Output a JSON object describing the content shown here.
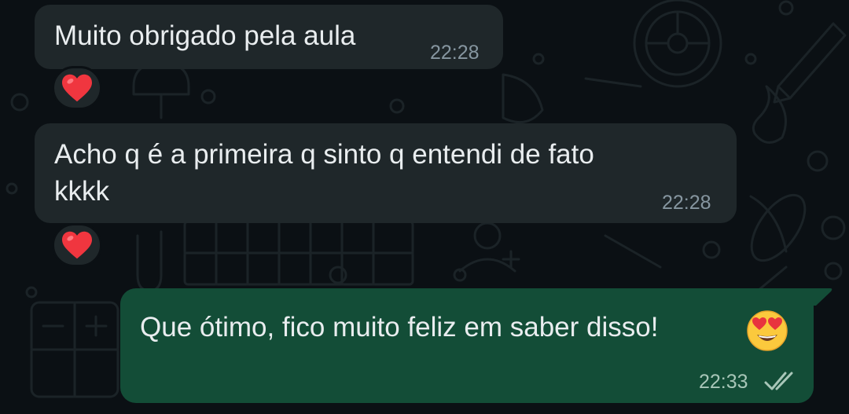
{
  "colors": {
    "background": "#0b1014",
    "incoming_bubble": "#1f272a",
    "outgoing_bubble": "#134d37",
    "text": "#e9edef",
    "timestamp": "#8696a0",
    "read_ticks": "#a8c6b8"
  },
  "messages": [
    {
      "direction": "incoming",
      "lines": [
        "Muito obrigado pela aula"
      ],
      "time": "22:28",
      "reaction": "heart-icon"
    },
    {
      "direction": "incoming",
      "lines": [
        "Acho q é a primeira q sinto q entendi de fato",
        "kkkk"
      ],
      "time": "22:28",
      "reaction": "heart-icon"
    },
    {
      "direction": "outgoing",
      "lines": [
        "Que ótimo, fico muito feliz em saber disso!"
      ],
      "emoji": "heart-eyes-emoji",
      "time": "22:33",
      "status": "double-check-icon"
    }
  ]
}
